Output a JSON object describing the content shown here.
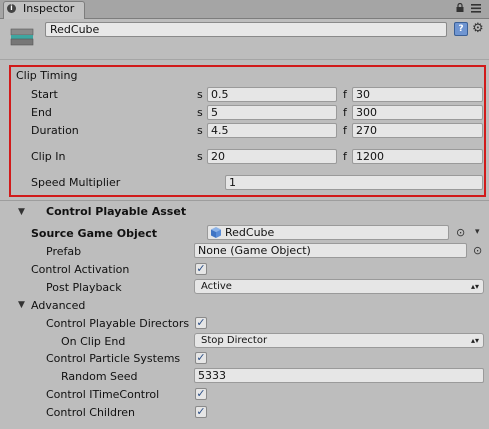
{
  "tab": {
    "title": "Inspector"
  },
  "header": {
    "object_name": "RedCube"
  },
  "clip_timing": {
    "title": "Clip Timing",
    "rows": [
      {
        "label": "Start",
        "s_unit": "s",
        "s_value": "0.5",
        "f_unit": "f",
        "f_value": "30"
      },
      {
        "label": "End",
        "s_unit": "s",
        "s_value": "5",
        "f_unit": "f",
        "f_value": "300"
      },
      {
        "label": "Duration",
        "s_unit": "s",
        "s_value": "4.5",
        "f_unit": "f",
        "f_value": "270"
      },
      {
        "label": "Clip In",
        "s_unit": "s",
        "s_value": "20",
        "f_unit": "f",
        "f_value": "1200"
      }
    ],
    "speed_label": "Speed Multiplier",
    "speed_value": "1"
  },
  "component": {
    "title": "Control Playable Asset",
    "source_label": "Source Game Object",
    "source_value": "RedCube",
    "prefab_label": "Prefab",
    "prefab_value": "None (Game Object)",
    "activation_label": "Control Activation",
    "activation_checked": true,
    "post_playback_label": "Post Playback",
    "post_playback_value": "Active",
    "advanced_label": "Advanced",
    "directors_label": "Control Playable Directors",
    "directors_checked": true,
    "on_clip_end_label": "On Clip End",
    "on_clip_end_value": "Stop Director",
    "particles_label": "Control Particle Systems",
    "particles_checked": true,
    "random_seed_label": "Random Seed",
    "random_seed_value": "5333",
    "itime_label": "Control ITimeControl",
    "itime_checked": true,
    "children_label": "Control Children",
    "children_checked": true
  }
}
